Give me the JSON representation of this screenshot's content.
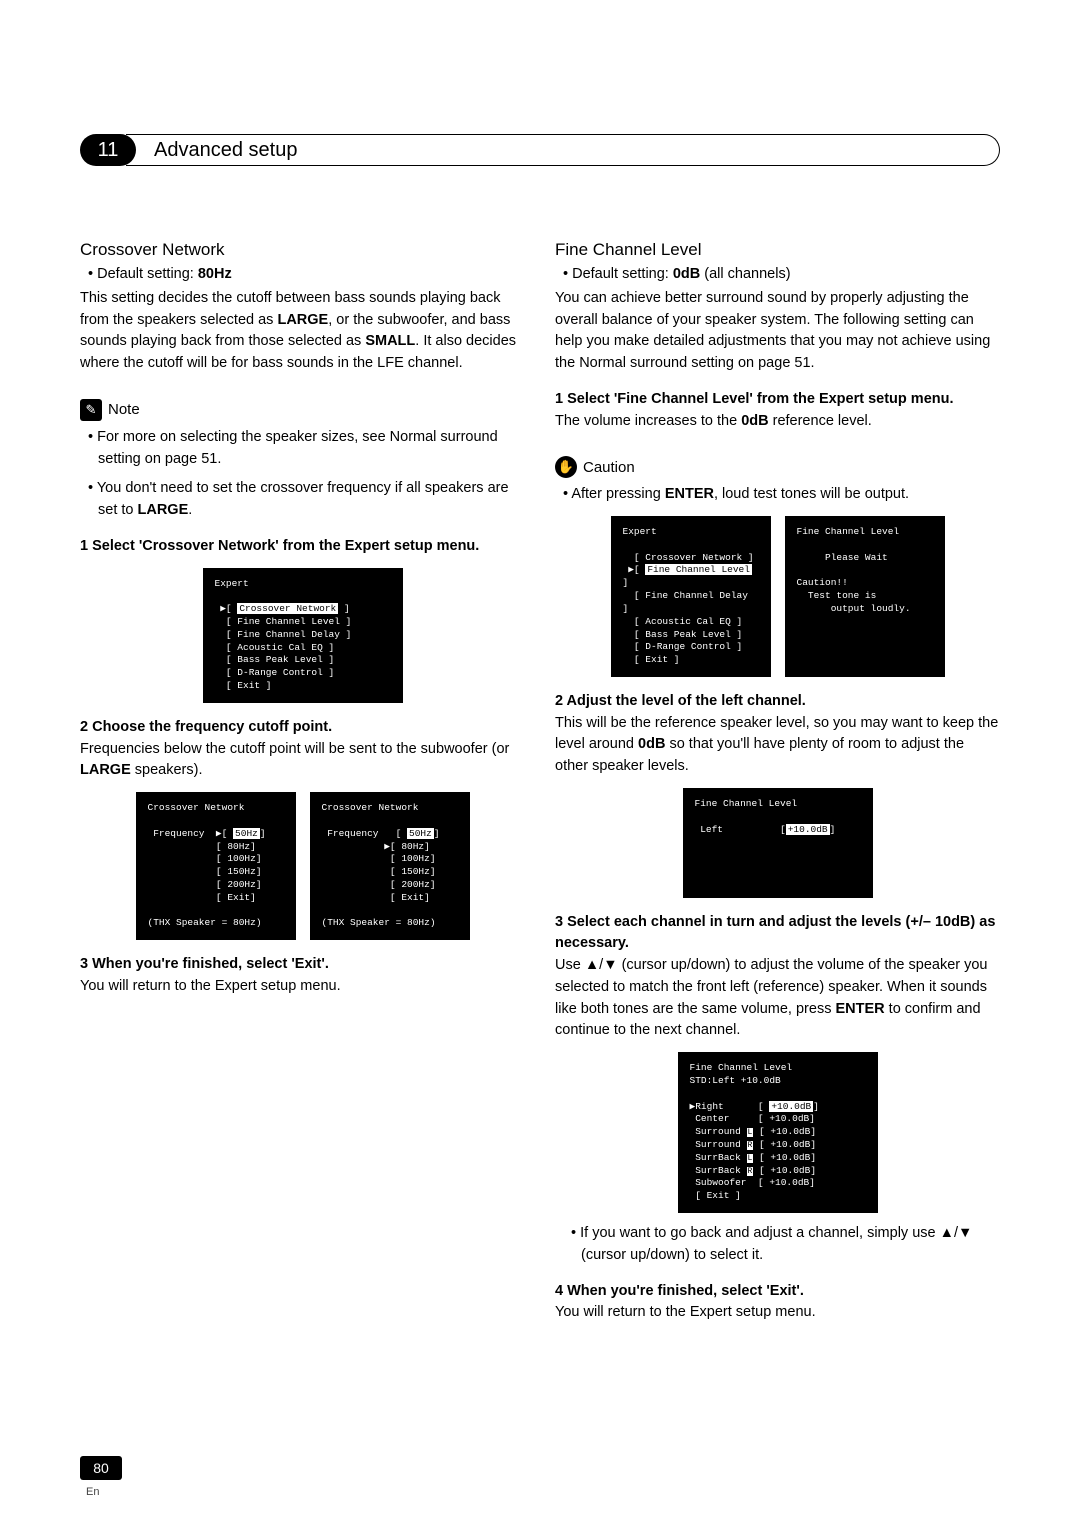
{
  "chapter": {
    "number": "11",
    "title": "Advanced setup"
  },
  "left": {
    "h1": "Crossover Network",
    "default": "Default setting: ",
    "default_val": "80Hz",
    "intro1": "This setting decides the cutoff between bass sounds playing back from the speakers selected as ",
    "intro_b1": "LARGE",
    "intro2": ", or the subwoofer, and bass sounds playing back from those selected as ",
    "intro_b2": "SMALL",
    "intro3": ". It also decides where the cutoff will be for bass sounds in the LFE channel.",
    "note_label": "Note",
    "note1a": "For more on selecting the speaker sizes, see ",
    "note1b": "Normal surround setting",
    "note1c": " on page 51.",
    "note2a": "You don't need to set the crossover frequency if all speakers are set to ",
    "note2b": "LARGE",
    "note2c": ".",
    "step1": "1   Select 'Crossover Network' from the Expert setup menu.",
    "step2": "2   Choose the frequency cutoff point.",
    "step2_body_a": "Frequencies below the cutoff point will be sent to the subwoofer (or ",
    "step2_body_b": "LARGE",
    "step2_body_c": " speakers).",
    "step3": "3   When you're finished, select 'Exit'.",
    "step3_body": "You will return to the Expert setup menu.",
    "osd1": {
      "title": "Expert",
      "items": [
        "Crossover Network",
        "Fine Channel Level",
        "Fine Channel Delay",
        "Acoustic Cal EQ",
        "Bass Peak Level",
        "D-Range Control",
        "Exit"
      ]
    },
    "osd2": {
      "title": "Crossover Network",
      "label": "Frequency",
      "opts": [
        "50Hz",
        "80Hz",
        "100Hz",
        "150Hz",
        "200Hz",
        "Exit"
      ],
      "foot": "(THX Speaker = 80Hz)"
    }
  },
  "right": {
    "h1": "Fine Channel Level",
    "default": "Default setting: ",
    "default_val": "0dB",
    "default_tail": " (all channels)",
    "intro1": "You can achieve better surround sound by properly adjusting the overall balance of your speaker system. The following setting can help you make detailed adjustments that you may not achieve using the ",
    "intro_b1": "Normal surround setting",
    "intro2": " on page 51.",
    "step1": "1   Select 'Fine Channel Level' from the Expert setup menu.",
    "step1_body_a": "The volume increases to the ",
    "step1_body_b": "0dB",
    "step1_body_c": " reference level.",
    "caution_label": "Caution",
    "caution1a": "After pressing ",
    "caution1b": "ENTER",
    "caution1c": ", loud test tones will be output.",
    "osd1a": {
      "title": "Expert",
      "items": [
        "Crossover Network",
        "Fine Channel Level",
        "Fine Channel Delay",
        "Acoustic Cal EQ",
        "Bass Peak Level",
        "D-Range Control",
        "Exit"
      ]
    },
    "osd1b": {
      "title": "Fine Channel Level",
      "l1": "Please Wait",
      "l2": "Caution!!",
      "l3": "Test tone is",
      "l4": "output loudly."
    },
    "step2": "2   Adjust the level of the left channel.",
    "step2_body_a": "This will be the reference speaker level, so you may want to keep the level around ",
    "step2_body_b": "0dB",
    "step2_body_c": " so that you'll have plenty of room to adjust the other speaker levels.",
    "osd2": {
      "title": "Fine Channel Level",
      "label": "Left",
      "val": "+10.0dB"
    },
    "step3": "3   Select each channel in turn and adjust the levels (+/– 10dB) as necessary.",
    "step3_body_a": "Use ▲/▼ (cursor up/down) to adjust the volume of the speaker you selected to match the front left (reference) speaker. When it sounds like both tones are the same volume, press ",
    "step3_body_b": "ENTER",
    "step3_body_c": " to confirm and continue to the next channel.",
    "osd3": {
      "title": "Fine Channel Level",
      "std": "STD:Left          +10.0dB",
      "rows": [
        [
          "Right",
          "",
          "+10.0dB",
          true
        ],
        [
          "Center",
          "",
          "+10.0dB",
          false
        ],
        [
          "Surround",
          "L",
          "+10.0dB",
          false
        ],
        [
          "Surround",
          "R",
          "+10.0dB",
          false
        ],
        [
          "SurrBack",
          "L",
          "+10.0dB",
          false
        ],
        [
          "SurrBack",
          "R",
          "+10.0dB",
          false
        ],
        [
          "Subwoofer",
          "",
          "+10.0dB",
          false
        ]
      ],
      "exit": "[ Exit ]"
    },
    "tip": "If you want to go back and adjust a channel, simply use ▲/▼ (cursor up/down) to select it.",
    "step4": "4   When you're finished, select 'Exit'.",
    "step4_body": "You will return to the Expert setup menu."
  },
  "page": {
    "num": "80",
    "lang": "En"
  }
}
